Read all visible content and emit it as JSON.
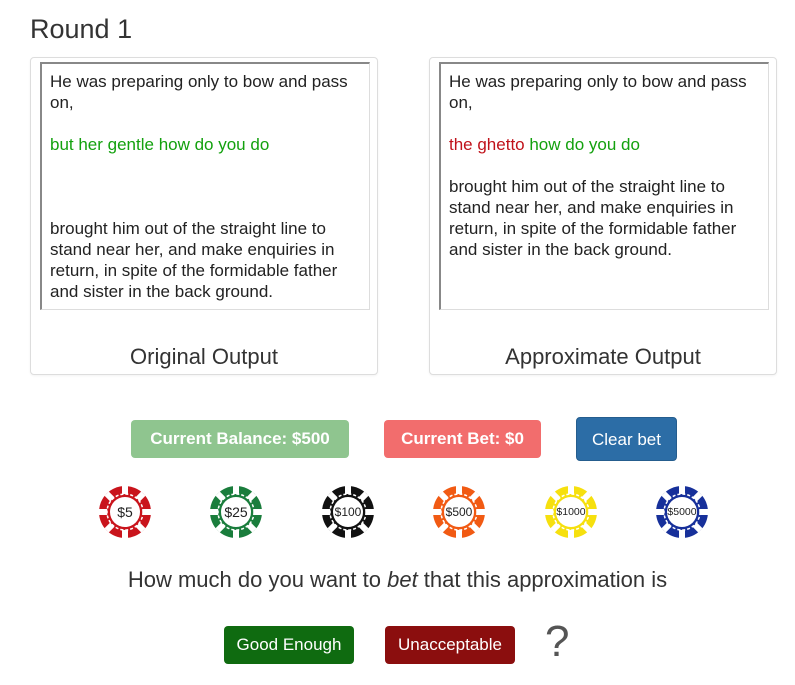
{
  "header": {
    "title": "Round 1"
  },
  "original": {
    "line1": "He was preparing only to bow and pass on,",
    "highlight_green": "but her gentle how do you do",
    "line2": "brought him out of the straight line to stand near her, and make enquiries in return, in spite of the formidable father and sister in the back ground.",
    "label": "Original Output"
  },
  "approximate": {
    "line1": "He was preparing only to bow and pass on,",
    "highlight_red": "the ghetto",
    "highlight_green": " how do you do",
    "line2": "brought him out of the straight line to stand near her, and make enquiries in return, in spite of the formidable father and sister in the back ground.",
    "label": "Approximate Output"
  },
  "betting": {
    "balance_label": "Current Balance: $500",
    "bet_label": "Current Bet: $0",
    "clear_label": "Clear bet",
    "chips": [
      {
        "label": "$5",
        "color": "#c9141c"
      },
      {
        "label": "$25",
        "color": "#1a7d3c"
      },
      {
        "label": "$100",
        "color": "#111111"
      },
      {
        "label": "$500",
        "color": "#f15a13"
      },
      {
        "label": "$1000",
        "color": "#f6e00e"
      },
      {
        "label": "$5000",
        "color": "#17309a"
      }
    ]
  },
  "question": {
    "prefix": "How much do you want to ",
    "emphasis": "bet",
    "suffix": " that this approximation is",
    "good_label": "Good Enough",
    "unacceptable_label": "Unacceptable",
    "mark": "?"
  }
}
